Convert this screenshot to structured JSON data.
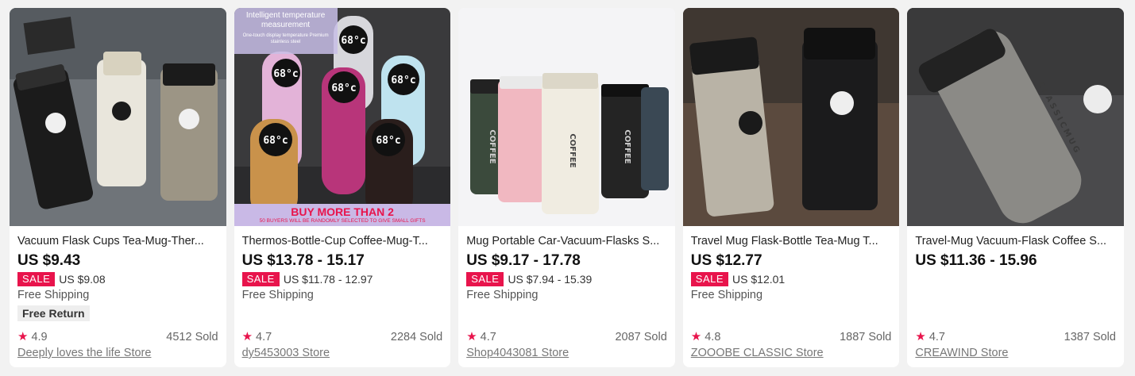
{
  "products": [
    {
      "title": "Vacuum Flask Cups Tea-Mug-Ther...",
      "price": "US $9.43",
      "sale_badge": "SALE",
      "sale_price": "US $9.08",
      "shipping": "Free Shipping",
      "free_return": "Free Return",
      "rating": "4.9",
      "sold": "4512 Sold",
      "store": "Deeply loves the life Store",
      "image": "black-white-silver-travel-mugs"
    },
    {
      "title": "Thermos-Bottle-Cup Coffee-Mug-T...",
      "price": "US $13.78 - 15.17",
      "sale_badge": "SALE",
      "sale_price": "US $11.78 - 12.97",
      "shipping": "Free Shipping",
      "rating": "4.7",
      "sold": "2284 Sold",
      "store": "dy5453003 Store",
      "image": "smart-temperature-bottles",
      "banner_top": "Intelligent temperature measurement",
      "banner_top_sub": "One-touch display temperature Premium stainless steel",
      "banner_bottom": "BUY MORE THAN 2",
      "banner_bottom_sub": "50 BUYERS WILL BE RANDOMLY SELECTED TO GIVE SMALL GIFTS",
      "display_temp": "68°c"
    },
    {
      "title": "Mug Portable Car-Vacuum-Flasks S...",
      "price": "US $9.17 - 17.78",
      "sale_badge": "SALE",
      "sale_price": "US $7.94 - 15.39",
      "shipping": "Free Shipping",
      "rating": "4.7",
      "sold": "2087 Sold",
      "store": "Shop4043081 Store",
      "image": "coffee-travel-mugs-colors",
      "mug_text": "COFFEE"
    },
    {
      "title": "Travel Mug Flask-Bottle Tea-Mug T...",
      "price": "US $12.77",
      "sale_badge": "SALE",
      "sale_price": "US $12.01",
      "shipping": "Free Shipping",
      "rating": "4.8",
      "sold": "1887 Sold",
      "store": "ZOOOBE CLASSIC Store",
      "image": "silver-black-travel-mugs"
    },
    {
      "title": "Travel-Mug Vacuum-Flask Coffee S...",
      "price": "US $11.36 - 15.96",
      "rating": "4.7",
      "sold": "1387 Sold",
      "store": "CREAWIND Store",
      "image": "silver-classicmug-bottle",
      "mug_text": "CLASSICMUG"
    }
  ],
  "colors": {
    "sale": "#e8144c",
    "star": "#e8144c"
  },
  "star_icon": "star-icon"
}
